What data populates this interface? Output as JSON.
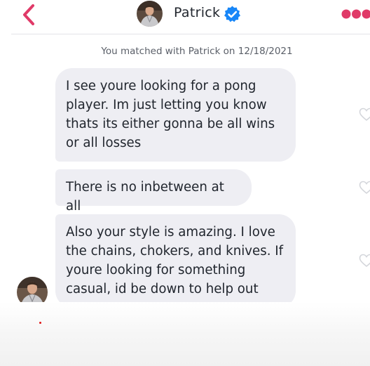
{
  "header": {
    "contact_name": "Patrick",
    "back_icon": "chevron-left-icon",
    "verified_icon": "verified-check-icon",
    "more_icon": "more-dots-icon",
    "accent_color": "#e03a68",
    "verified_color": "#1786f8"
  },
  "match_info": {
    "text": "You matched with Patrick on 12/18/2021"
  },
  "messages": [
    {
      "text": "I see youre looking for a pong\nplayer. Im just letting you know\nthats its either gonna be all wins\nor all losses"
    },
    {
      "text": "There is no inbetween at all"
    },
    {
      "text": "Also your style is amazing. I love\nthe chains, chokers, and knives. If\nyoure looking for something\ncasual, id be down to help out"
    }
  ],
  "bubble_color": "#eeeef3",
  "like_icon": "heart-outline-icon"
}
